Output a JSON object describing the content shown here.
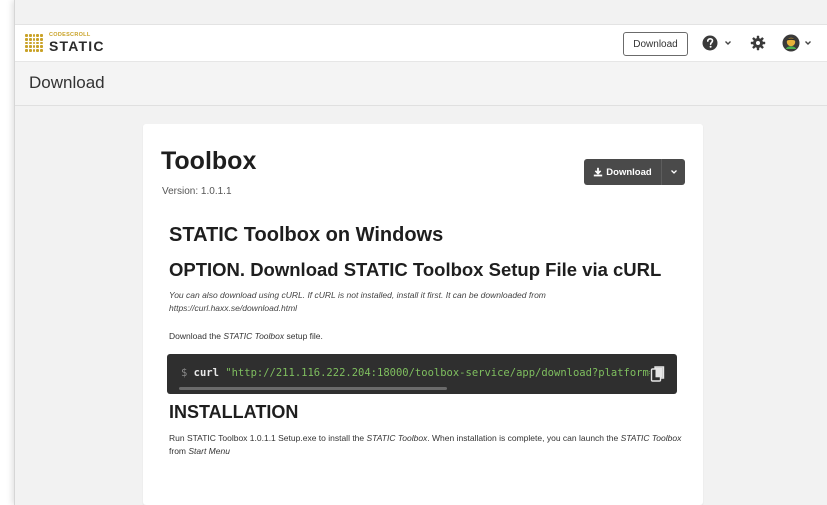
{
  "header": {
    "logo_sub": "CODESCROLL",
    "logo_main": "STATIC",
    "download_button": "Download",
    "icons": [
      "help-icon",
      "chevron-down-icon",
      "gear-icon",
      "avatar-icon"
    ]
  },
  "page": {
    "title": "Download"
  },
  "card": {
    "title": "Toolbox",
    "version_label": "Version:",
    "version_value": "1.0.1.1",
    "download_button": "Download",
    "heading_windows": "STATIC Toolbox on Windows",
    "heading_option": "OPTION. Download STATIC Toolbox Setup File via cURL",
    "curl_note": "You can also download using cURL. If cURL is not installed, install it first. It can be downloaded from https://curl.haxx.se/download.html",
    "lead_pre": "Download the ",
    "lead_em": "STATIC Toolbox",
    "lead_post": " setup file.",
    "code": {
      "prompt": "$",
      "command": "curl",
      "url": "\"http://211.116.222.204:18000/toolbox-service/app/download?platform="
    },
    "heading_install": "INSTALLATION",
    "install": {
      "t1": "Run STATIC Toolbox 1.0.1.1 Setup.exe to install the ",
      "e1": "STATIC Toolbox",
      "t2": ". When installation is complete, you can launch the ",
      "e2": "STATIC Toolbox",
      "t3": " from ",
      "e3": "Start Menu"
    }
  },
  "colors": {
    "accent": "#c9a227",
    "dark_button": "#4a4a4a",
    "code_bg": "#2f2f2f",
    "code_url": "#7fbf5f"
  }
}
